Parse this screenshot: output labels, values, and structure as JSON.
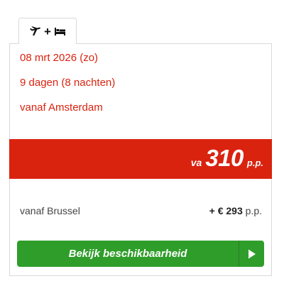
{
  "tab": {
    "icons": [
      "airplane-icon",
      "bed-icon"
    ],
    "plus": "+"
  },
  "trip": {
    "date": "08 mrt 2026 (zo)",
    "duration": "9 dagen (8 nachten)",
    "departure": "vanaf Amsterdam"
  },
  "price": {
    "prefix": "va",
    "amount": "310",
    "suffix": "p.p."
  },
  "alternative": {
    "label": "vanaf Brussel",
    "amount": "+ € 293",
    "suffix": " p.p."
  },
  "cta": {
    "label": "Bekijk beschikbaarheid",
    "icon": "play-arrow-icon"
  },
  "colors": {
    "accent_red": "#d9230f",
    "button_green": "#2f9d2a"
  }
}
